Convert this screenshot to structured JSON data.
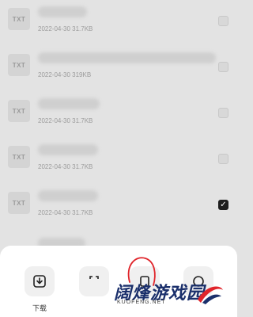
{
  "files": [
    {
      "icon": "TXT",
      "meta": "2022-04-30  31.7KB",
      "checked": false
    },
    {
      "icon": "TXT",
      "meta": "2022-04-30  319KB",
      "checked": false
    },
    {
      "icon": "TXT",
      "meta": "2022-04-30  31.7KB",
      "checked": false
    },
    {
      "icon": "TXT",
      "meta": "2022-04-30  31.7KB",
      "checked": false
    },
    {
      "icon": "TXT",
      "meta": "2022-04-30  31.7KB",
      "checked": true
    }
  ],
  "sheet": {
    "download_label": "下载"
  },
  "watermark": {
    "title": "阔烽游戏园",
    "sub": "KUOFENG.NET"
  },
  "colors": {
    "checked": "#1f1f1f",
    "annotation": "#e0242a",
    "watermark": "#1a2f6b"
  }
}
